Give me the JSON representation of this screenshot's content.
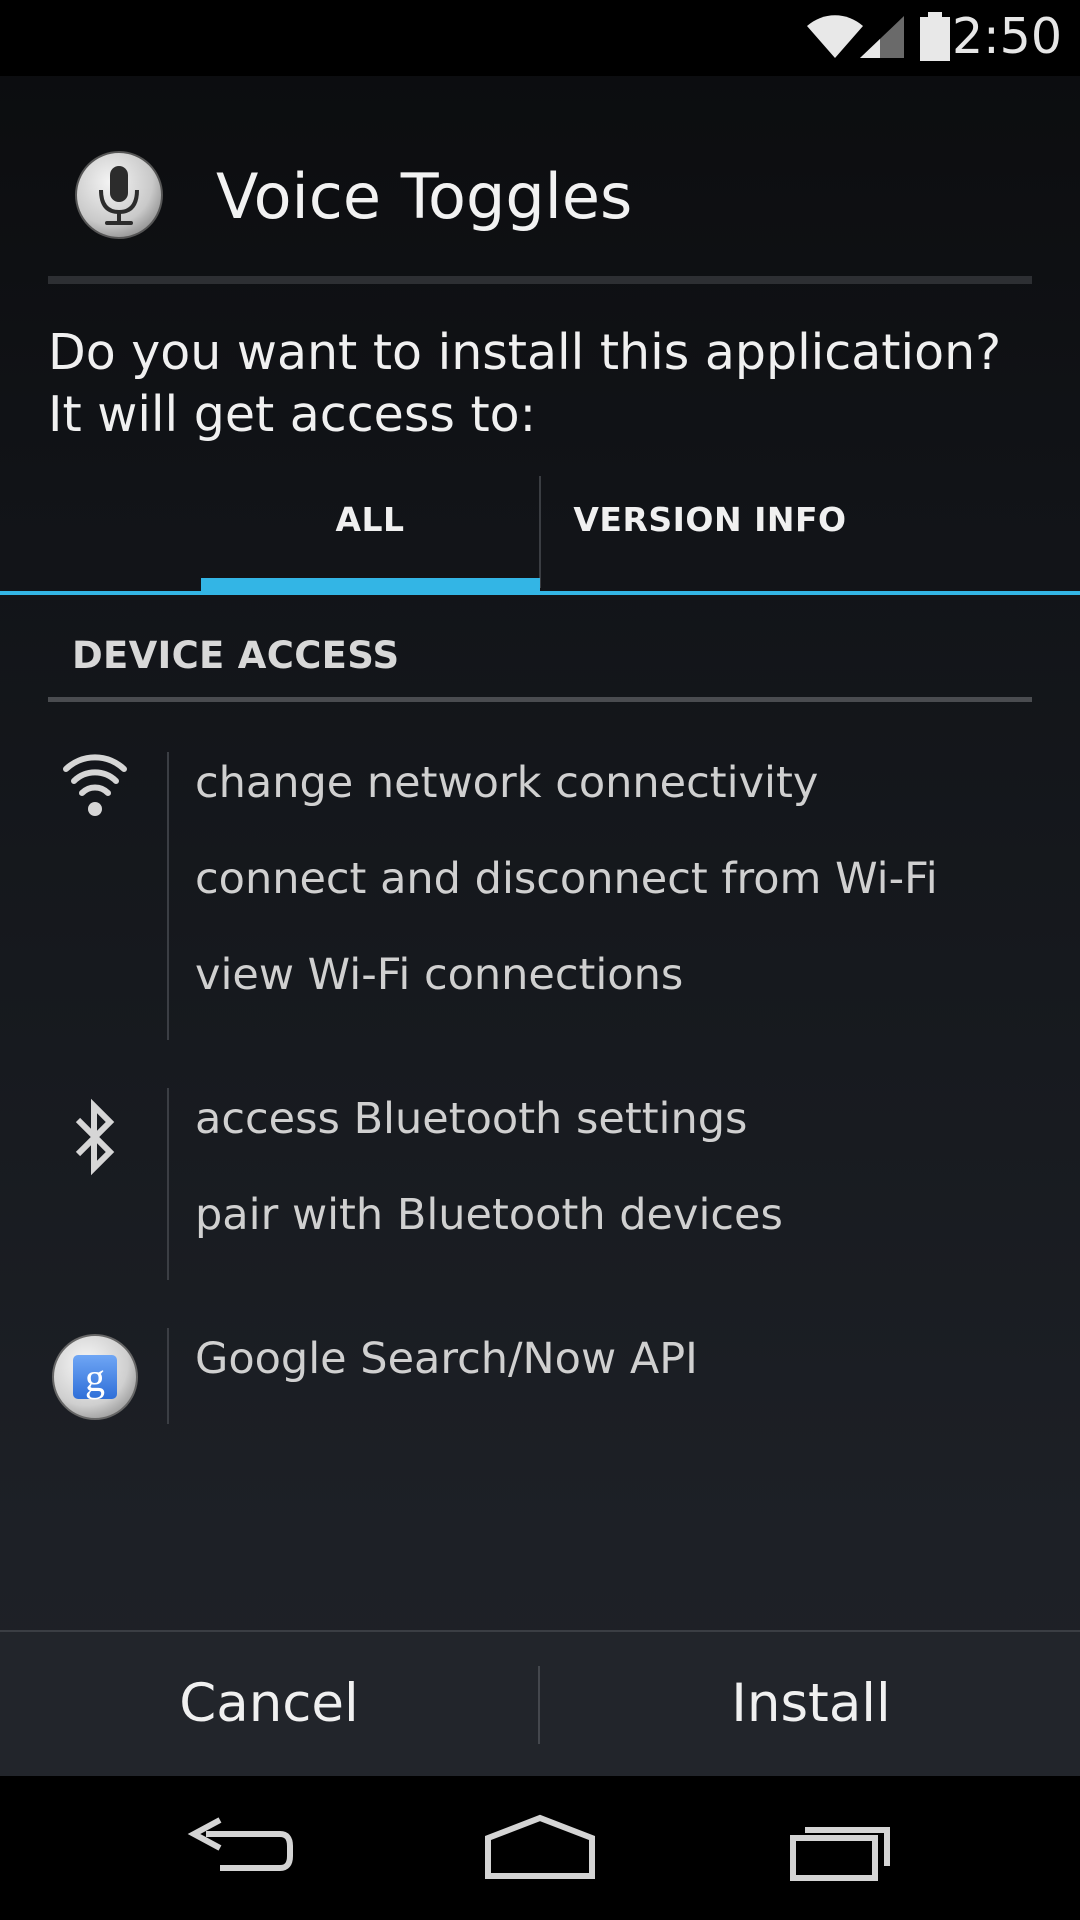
{
  "status_bar": {
    "time": "2:50",
    "icons": [
      "wifi-icon",
      "cell-signal-icon",
      "battery-icon"
    ]
  },
  "dialog": {
    "app_icon": "microphone-icon",
    "title": "Voice Toggles",
    "prompt": "Do you want to install this application? It will get access to:"
  },
  "tabs": {
    "all_label": "ALL",
    "version_label": "VERSION INFO",
    "selected": "ALL",
    "accent_color": "#33b5e5"
  },
  "section": {
    "header": "DEVICE ACCESS"
  },
  "permission_groups": [
    {
      "icon": "wifi-icon",
      "items": [
        "change network connectivity",
        "connect and disconnect from Wi-Fi",
        "view Wi-Fi connections"
      ]
    },
    {
      "icon": "bluetooth-icon",
      "items": [
        "access Bluetooth settings",
        "pair with Bluetooth devices"
      ]
    },
    {
      "icon": "google-search-icon",
      "items": [
        "Google Search/Now API"
      ]
    }
  ],
  "buttons": {
    "cancel": "Cancel",
    "install": "Install"
  },
  "nav_bar": {
    "icons": [
      "back-icon",
      "home-icon",
      "recents-icon"
    ]
  }
}
